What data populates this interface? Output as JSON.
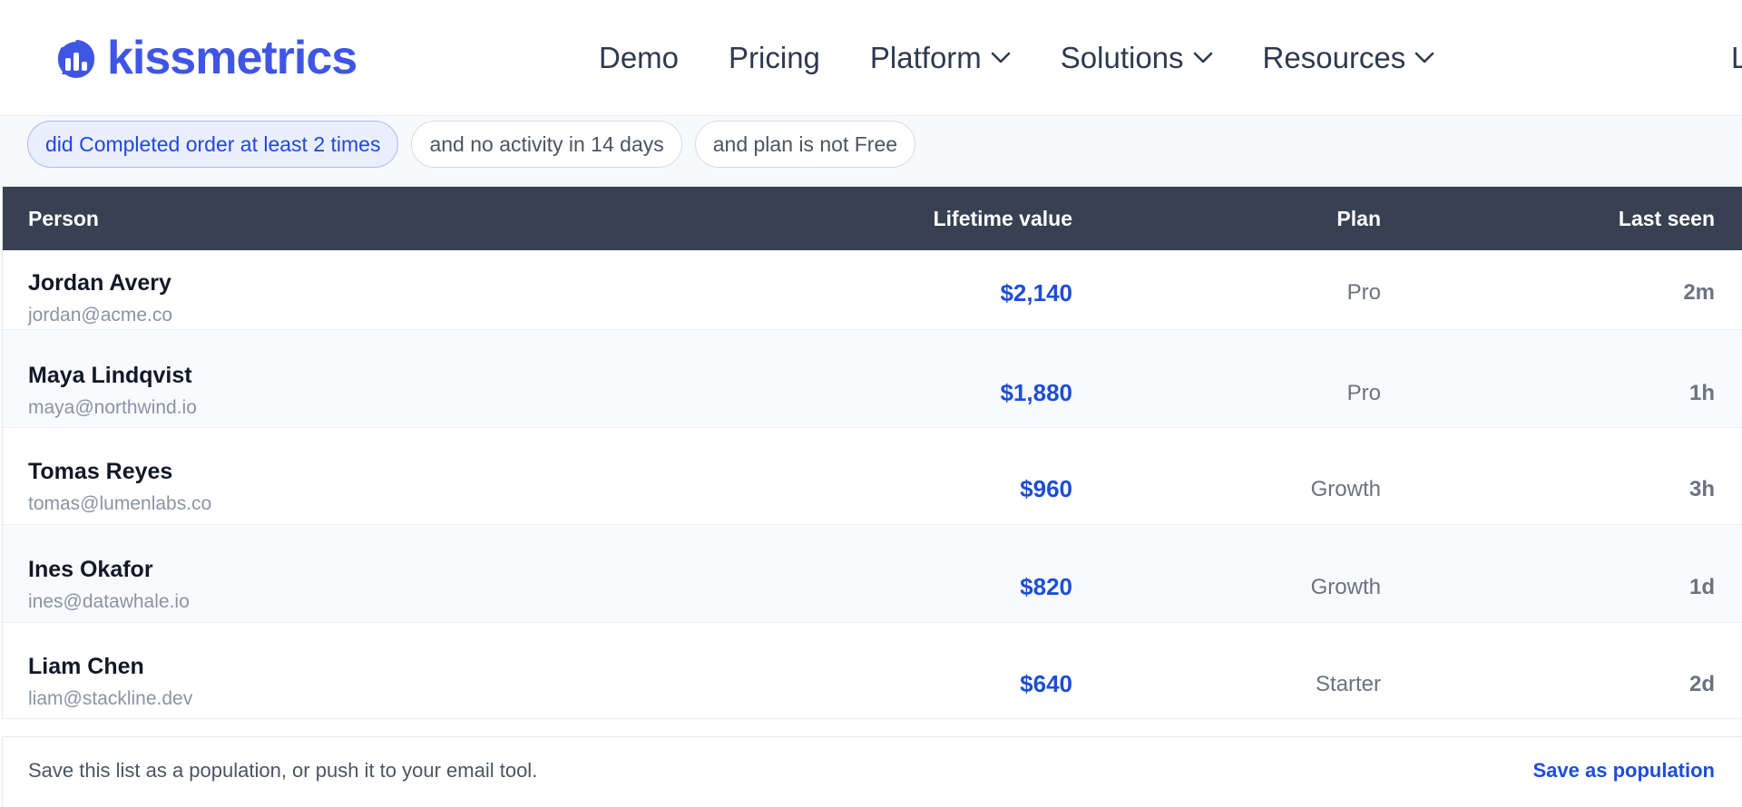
{
  "nav": {
    "brand": "kissmetrics",
    "items": [
      {
        "label": "Demo",
        "has_menu": false
      },
      {
        "label": "Pricing",
        "has_menu": false
      },
      {
        "label": "Platform",
        "has_menu": true
      },
      {
        "label": "Solutions",
        "has_menu": true
      },
      {
        "label": "Resources",
        "has_menu": true
      }
    ],
    "cut_off_item": "L"
  },
  "filters": [
    {
      "label": "did Completed order at least 2 times",
      "active": true
    },
    {
      "label": "and no activity in 14 days",
      "active": false
    },
    {
      "label": "and plan is not Free",
      "active": false
    }
  ],
  "table": {
    "columns": {
      "person": "Person",
      "lifetime_value": "Lifetime value",
      "plan": "Plan",
      "last_seen": "Last seen"
    },
    "rows": [
      {
        "name": "Jordan Avery",
        "email": "jordan@acme.co",
        "ltv": "$2,140",
        "plan": "Pro",
        "last_seen": "2m"
      },
      {
        "name": "Maya Lindqvist",
        "email": "maya@northwind.io",
        "ltv": "$1,880",
        "plan": "Pro",
        "last_seen": "1h"
      },
      {
        "name": "Tomas Reyes",
        "email": "tomas@lumenlabs.co",
        "ltv": "$960",
        "plan": "Growth",
        "last_seen": "3h"
      },
      {
        "name": "Ines Okafor",
        "email": "ines@datawhale.io",
        "ltv": "$820",
        "plan": "Growth",
        "last_seen": "1d"
      },
      {
        "name": "Liam Chen",
        "email": "liam@stackline.dev",
        "ltv": "$640",
        "plan": "Starter",
        "last_seen": "2d"
      }
    ]
  },
  "footer": {
    "note": "Save this list as a population, or push it to your email tool.",
    "action": "Save as population"
  },
  "colors": {
    "brand": "#3f55e6",
    "header_bg": "#374151",
    "value_blue": "#1d4ed8",
    "active_chip_bg": "#e9effd"
  }
}
